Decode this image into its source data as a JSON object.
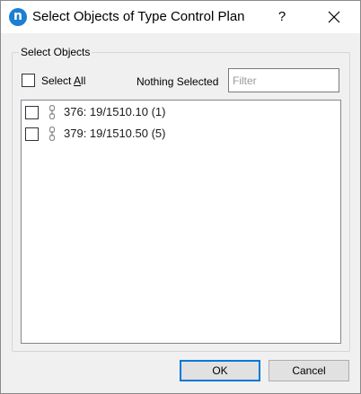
{
  "window": {
    "app_icon_letter": "n",
    "title": "Select Objects of Type Control Plan",
    "help_label": "?",
    "close_icon": "close-icon"
  },
  "group": {
    "title": "Select Objects",
    "select_all_prefix": "Select ",
    "select_all_mnemonic": "A",
    "select_all_suffix": "ll",
    "select_all_checked": false,
    "selection_status": "Nothing Selected",
    "filter_value": "",
    "filter_placeholder": "Filter"
  },
  "items": [
    {
      "label": "376: 19/1510.10 (1)",
      "checked": false,
      "icon": "link-chain-icon"
    },
    {
      "label": "379: 19/1510.50 (5)",
      "checked": false,
      "icon": "link-chain-icon"
    }
  ],
  "buttons": {
    "ok": "OK",
    "cancel": "Cancel"
  },
  "colors": {
    "accent": "#0078d7",
    "app_icon": "#1c7fd1"
  }
}
